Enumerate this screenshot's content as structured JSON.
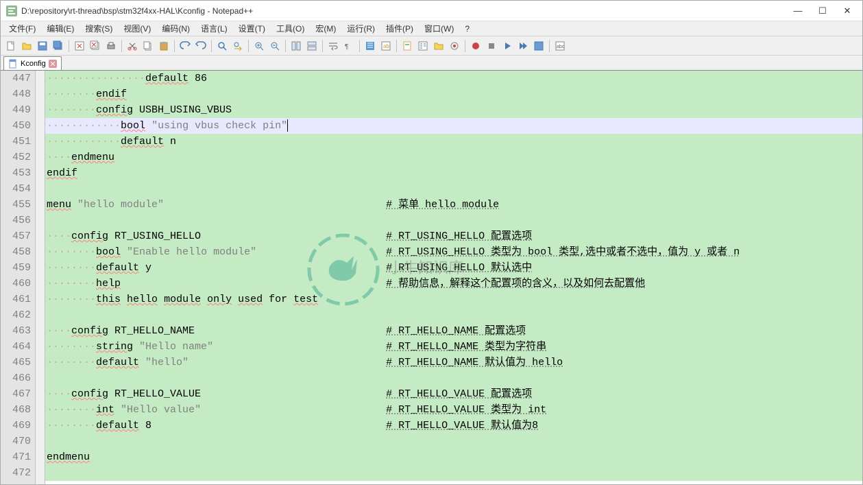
{
  "titlebar": {
    "title": "D:\\repository\\rt-thread\\bsp\\stm32f4xx-HAL\\Kconfig - Notepad++"
  },
  "menu": {
    "items": [
      "文件(F)",
      "编辑(E)",
      "搜索(S)",
      "视图(V)",
      "编码(N)",
      "语言(L)",
      "设置(T)",
      "工具(O)",
      "宏(M)",
      "运行(R)",
      "插件(P)",
      "窗口(W)",
      "?"
    ]
  },
  "tab": {
    "name": "Kconfig"
  },
  "lines": {
    "start": 447,
    "count": 26,
    "447": {
      "ws": "················",
      "code": "default 86"
    },
    "448": {
      "ws": "········",
      "code": "endif"
    },
    "449": {
      "ws": "········",
      "code": "config USBH_USING_VBUS"
    },
    "450": {
      "ws": "············",
      "code": "bool \"using vbus check pin\""
    },
    "451": {
      "ws": "············",
      "code": "default n"
    },
    "452": {
      "ws": "····",
      "code": "endmenu"
    },
    "453": {
      "ws": "",
      "code": "endif"
    },
    "454": {
      "ws": "",
      "code": ""
    },
    "455": {
      "ws": "",
      "code": "menu \"hello module\"",
      "cm": "# 菜单 hello module",
      "col": 55
    },
    "456": {
      "ws": "",
      "code": ""
    },
    "457": {
      "ws": "····",
      "code": "config RT_USING_HELLO",
      "cm": "# RT_USING_HELLO 配置选项",
      "col": 55
    },
    "458": {
      "ws": "········",
      "code": "bool \"Enable hello module\"",
      "cm": "# RT_USING_HELLO 类型为 bool 类型,选中或者不选中，值为 y 或者 n",
      "col": 55
    },
    "459": {
      "ws": "········",
      "code": "default y",
      "cm": "# RT_USING_HELLO 默认选中",
      "col": 55
    },
    "460": {
      "ws": "········",
      "code": "help",
      "cm": "# 帮助信息，解释这个配置项的含义，以及如何去配置他",
      "col": 55
    },
    "461": {
      "ws": "········",
      "code": "this hello module only used for test"
    },
    "462": {
      "ws": "",
      "code": ""
    },
    "463": {
      "ws": "····",
      "code": "config RT_HELLO_NAME",
      "cm": "# RT_HELLO_NAME 配置选项",
      "col": 55
    },
    "464": {
      "ws": "········",
      "code": "string \"Hello name\"",
      "cm": "# RT_HELLO_NAME 类型为字符串",
      "col": 55
    },
    "465": {
      "ws": "········",
      "code": "default \"hello\"",
      "cm": "# RT_HELLO_NAME 默认值为 hello",
      "col": 55
    },
    "466": {
      "ws": "",
      "code": ""
    },
    "467": {
      "ws": "····",
      "code": "config RT_HELLO_VALUE",
      "cm": "# RT_HELLO_VALUE 配置选项",
      "col": 55
    },
    "468": {
      "ws": "········",
      "code": "int \"Hello value\"",
      "cm": "# RT_HELLO_VALUE 类型为 int",
      "col": 55
    },
    "469": {
      "ws": "········",
      "code": "default 8",
      "cm": "# RT_HELLO_VALUE 默认值为8",
      "col": 55
    },
    "470": {
      "ws": "",
      "code": ""
    },
    "471": {
      "ws": "",
      "code": "endmenu"
    },
    "472": {
      "ws": "",
      "code": ""
    }
  },
  "keywords": [
    "endif",
    "config",
    "bool",
    "default",
    "endmenu",
    "menu",
    "help",
    "string",
    "int",
    "this",
    "hello",
    "module",
    "only",
    "used",
    "test"
  ],
  "watermark": {
    "text": "小牛知识库"
  },
  "current_line": 450
}
